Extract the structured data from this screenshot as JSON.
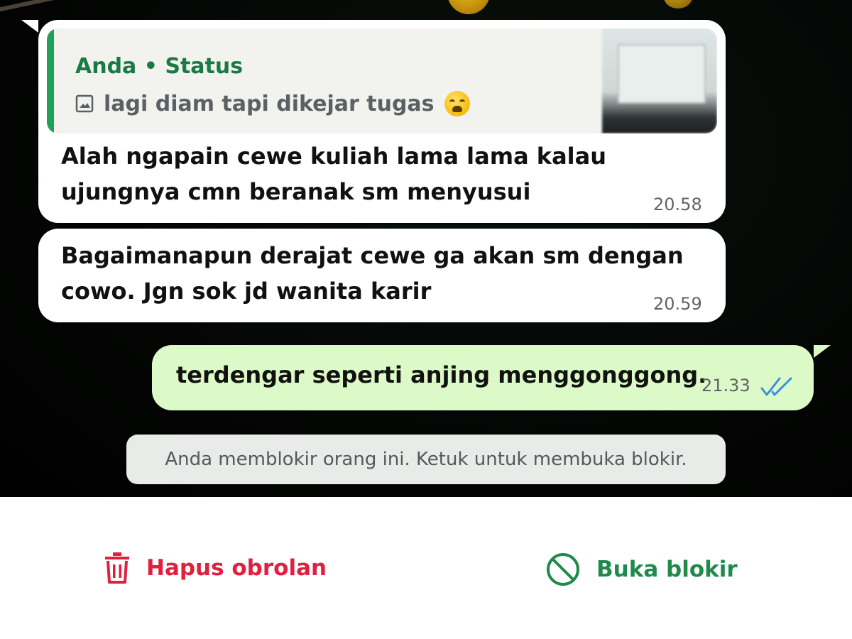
{
  "chat": {
    "quoted_status": {
      "author": "Anda • Status",
      "caption": "lagi diam tapi dikejar tugas",
      "emoji_icon": "weary-face-emoji"
    },
    "messages": [
      {
        "direction": "incoming",
        "lines": [
          "Alah ngapain cewe kuliah lama lama kalau",
          "ujungnya cmn beranak sm menyusui"
        ],
        "time": "20.58"
      },
      {
        "direction": "incoming",
        "lines": [
          "Bagaimanapun derajat cewe ga akan sm dengan",
          "cowo. Jgn sok jd wanita karir"
        ],
        "time": "20.59"
      },
      {
        "direction": "outgoing",
        "lines": [
          "terdengar seperti anjing menggonggong."
        ],
        "time": "21.33",
        "status_icon": "double-check-read-icon"
      }
    ],
    "system_notice": "Anda memblokir orang ini. Ketuk untuk membuka blokir."
  },
  "actions": {
    "delete_chat": {
      "label": "Hapus obrolan",
      "icon": "trash-icon",
      "color": "#e0203e"
    },
    "unblock": {
      "label": "Buka blokir",
      "icon": "block-icon",
      "color": "#1f8a4c"
    }
  },
  "colors": {
    "incoming_bubble": "#ffffff",
    "outgoing_bubble": "#dcfac7",
    "quote_accent": "#21a05a",
    "read_ticks": "#3b8fe0"
  }
}
